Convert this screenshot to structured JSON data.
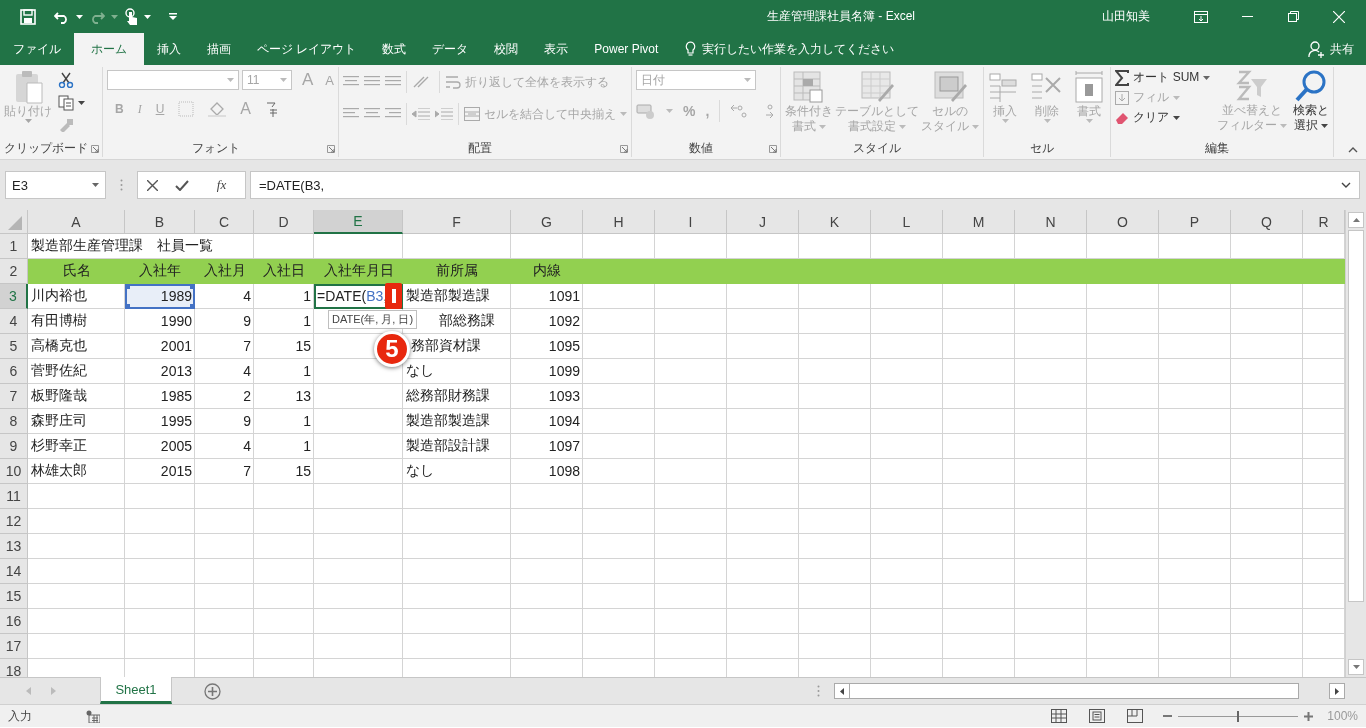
{
  "title_bar": {
    "title": "生産管理課社員名簿  -  Excel",
    "user": "山田知美"
  },
  "menu_tabs": [
    {
      "label": "ファイル",
      "selected": false
    },
    {
      "label": "ホーム",
      "selected": true
    },
    {
      "label": "挿入",
      "selected": false
    },
    {
      "label": "描画",
      "selected": false
    },
    {
      "label": "ページ レイアウト",
      "selected": false
    },
    {
      "label": "数式",
      "selected": false
    },
    {
      "label": "データ",
      "selected": false
    },
    {
      "label": "校閲",
      "selected": false
    },
    {
      "label": "表示",
      "selected": false
    },
    {
      "label": "Power Pivot",
      "selected": false
    }
  ],
  "tell_me": {
    "placeholder": "実行したい作業を入力してください"
  },
  "share": "共有",
  "ribbon": {
    "groups": [
      {
        "kind": "clipboard",
        "label": "クリップボード",
        "paste": {
          "label": "貼り付け",
          "disabled": true
        }
      },
      {
        "kind": "font",
        "label": "フォント",
        "font_size": "11",
        "disabled": true,
        "buttons": [
          {
            "kind": "grow",
            "label": "A"
          },
          {
            "kind": "shrink",
            "label": "A"
          },
          {
            "kind": "bold",
            "label": "B"
          },
          {
            "kind": "italic",
            "label": "I"
          },
          {
            "kind": "underline",
            "label": "U"
          },
          {
            "kind": "font-color",
            "label": "A"
          }
        ]
      },
      {
        "kind": "alignment",
        "label": "配置",
        "wrap": "折り返して全体を表示する",
        "merge": "セルを結合して中央揃え",
        "disabled": true
      },
      {
        "kind": "number",
        "label": "数値",
        "format": "日付",
        "symbols": [
          "%",
          ","
        ],
        "disabled": true
      },
      {
        "kind": "styles",
        "label": "スタイル",
        "items": [
          {
            "lines": [
              "条件付き",
              "書式"
            ],
            "disabled": true
          },
          {
            "lines": [
              "テーブルとして",
              "書式設定"
            ],
            "disabled": true
          },
          {
            "lines": [
              "セルの",
              "スタイル"
            ],
            "disabled": true
          }
        ]
      },
      {
        "kind": "cells",
        "label": "セル",
        "items": [
          {
            "lines": [
              "挿入"
            ],
            "disabled": true
          },
          {
            "lines": [
              "削除"
            ],
            "disabled": true
          },
          {
            "lines": [
              "書式"
            ],
            "disabled": true
          }
        ]
      },
      {
        "kind": "editing",
        "label": "編集",
        "autosum": {
          "label": "オート SUM",
          "disabled": false
        },
        "fill": {
          "label": "フィル",
          "disabled": true
        },
        "clear": {
          "label": "クリア",
          "disabled": false
        },
        "sort": {
          "lines": [
            "並べ替えと",
            "フィルター"
          ],
          "disabled": true
        },
        "find": {
          "lines": [
            "検索と",
            "選択"
          ],
          "disabled": false
        }
      }
    ]
  },
  "formula_bar": {
    "name_box": "E3",
    "fx": "fx",
    "formula": "=DATE(B3,"
  },
  "sheet": {
    "columns": [
      {
        "letter": "A",
        "selected": false
      },
      {
        "letter": "B",
        "selected": false,
        "numeric": true
      },
      {
        "letter": "C",
        "selected": false,
        "numeric": true
      },
      {
        "letter": "D",
        "selected": false,
        "numeric": true
      },
      {
        "letter": "E",
        "selected": true
      },
      {
        "letter": "F",
        "selected": false
      },
      {
        "letter": "G",
        "selected": false,
        "numeric": true
      },
      {
        "letter": "H",
        "selected": false
      },
      {
        "letter": "I",
        "selected": false
      },
      {
        "letter": "J",
        "selected": false
      },
      {
        "letter": "K",
        "selected": false
      },
      {
        "letter": "L",
        "selected": false
      },
      {
        "letter": "M",
        "selected": false
      },
      {
        "letter": "N",
        "selected": false
      },
      {
        "letter": "O",
        "selected": false
      },
      {
        "letter": "P",
        "selected": false
      },
      {
        "letter": "Q",
        "selected": false
      },
      {
        "letter": "R",
        "selected": false
      }
    ],
    "rows": [
      {
        "number": "1",
        "selected": false,
        "kind": "title",
        "cells": [
          "製造部生産管理課　社員一覧",
          null,
          null,
          null,
          null,
          null,
          null
        ]
      },
      {
        "number": "2",
        "selected": false,
        "kind": "header",
        "cells": [
          "氏名",
          "入社年",
          "入社月",
          "入社日",
          "入社年月日",
          "前所属",
          "内線"
        ]
      },
      {
        "number": "3",
        "selected": true,
        "kind": "data",
        "cells": [
          "川内裕也",
          {
            "text": "1989",
            "kind": "reference"
          },
          "4",
          "1",
          {
            "kind": "editing",
            "parts": [
              {
                "text": "=DATE(",
                "kind": "plain"
              },
              {
                "text": "B3",
                "kind": "reference"
              },
              {
                "text": ",",
                "kind": "plain"
              }
            ]
          },
          "製造部製造課",
          "1091"
        ]
      },
      {
        "number": "4",
        "selected": false,
        "kind": "data",
        "cells": [
          "有田博樹",
          "1990",
          "9",
          "1",
          null,
          {
            "text": "部総務課",
            "kind": "covered"
          },
          "1092"
        ]
      },
      {
        "number": "5",
        "selected": false,
        "kind": "data",
        "cells": [
          "高橋克也",
          "2001",
          "7",
          "15",
          null,
          {
            "text": "務部資材課",
            "kind": "clipped"
          },
          "1095"
        ]
      },
      {
        "number": "6",
        "selected": false,
        "kind": "data",
        "cells": [
          "菅野佐紀",
          "2013",
          "4",
          "1",
          null,
          "なし",
          "1099"
        ]
      },
      {
        "number": "7",
        "selected": false,
        "kind": "data",
        "cells": [
          "板野隆哉",
          "1985",
          "2",
          "13",
          null,
          "総務部財務課",
          "1093"
        ]
      },
      {
        "number": "8",
        "selected": false,
        "kind": "data",
        "cells": [
          "森野庄司",
          "1995",
          "9",
          "1",
          null,
          "製造部製造課",
          "1094"
        ]
      },
      {
        "number": "9",
        "selected": false,
        "kind": "data",
        "cells": [
          "杉野幸正",
          "2005",
          "4",
          "1",
          null,
          "製造部設計課",
          "1097"
        ]
      },
      {
        "number": "10",
        "selected": false,
        "kind": "data",
        "cells": [
          "林雄太郎",
          "2015",
          "7",
          "15",
          null,
          "なし",
          "1098"
        ]
      },
      {
        "number": "11",
        "selected": false,
        "kind": "data",
        "cells": []
      },
      {
        "number": "12",
        "selected": false,
        "kind": "data",
        "cells": []
      },
      {
        "number": "13",
        "selected": false,
        "kind": "data",
        "cells": []
      },
      {
        "number": "14",
        "selected": false,
        "kind": "data",
        "cells": []
      },
      {
        "number": "15",
        "selected": false,
        "kind": "data",
        "cells": []
      },
      {
        "number": "16",
        "selected": false,
        "kind": "data",
        "cells": []
      },
      {
        "number": "17",
        "selected": false,
        "kind": "data",
        "cells": []
      },
      {
        "number": "18",
        "selected": false,
        "kind": "data",
        "cells": []
      }
    ],
    "tooltip": "DATE(年, 月, 日)",
    "step_badge": "5"
  },
  "sheet_tabs": [
    {
      "label": "Sheet1",
      "selected": true
    }
  ],
  "status_bar": {
    "mode": "入力",
    "zoom": "100%",
    "level": 0.5
  }
}
